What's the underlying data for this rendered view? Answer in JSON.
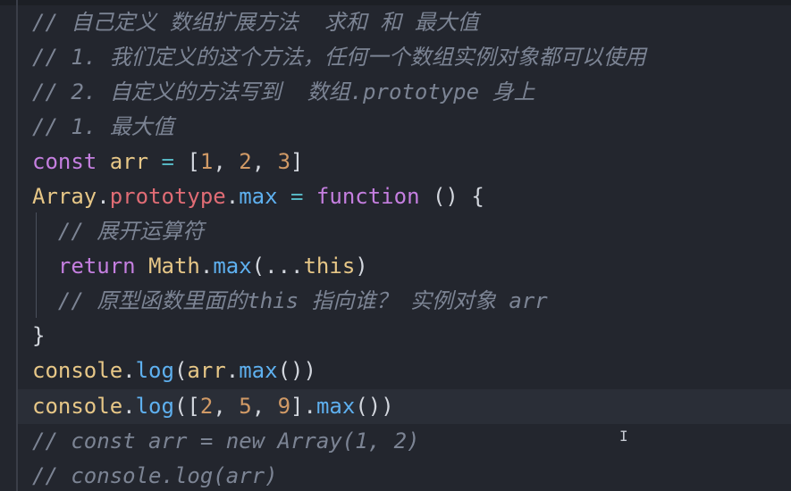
{
  "editor": {
    "lines": [
      {
        "segments": [
          {
            "text": "// 自己定义 数组扩展方法  求和 和 最大值",
            "cls": "comment"
          }
        ]
      },
      {
        "segments": [
          {
            "text": "// 1. 我们定义的这个方法，任何一个数组实例对象都可以使用",
            "cls": "comment"
          }
        ]
      },
      {
        "segments": [
          {
            "text": "// 2. 自定义的方法写到  数组.prototype 身上",
            "cls": "comment"
          }
        ]
      },
      {
        "segments": [
          {
            "text": "// 1. 最大值",
            "cls": "comment"
          }
        ]
      },
      {
        "segments": [
          {
            "text": "const",
            "cls": "kw"
          },
          {
            "text": " ",
            "cls": "punc"
          },
          {
            "text": "arr",
            "cls": "id"
          },
          {
            "text": " ",
            "cls": "punc"
          },
          {
            "text": "=",
            "cls": "op"
          },
          {
            "text": " [",
            "cls": "punc"
          },
          {
            "text": "1",
            "cls": "num"
          },
          {
            "text": ", ",
            "cls": "punc"
          },
          {
            "text": "2",
            "cls": "num"
          },
          {
            "text": ", ",
            "cls": "punc"
          },
          {
            "text": "3",
            "cls": "num"
          },
          {
            "text": "]",
            "cls": "punc"
          }
        ]
      },
      {
        "segments": [
          {
            "text": "Array",
            "cls": "id"
          },
          {
            "text": ".",
            "cls": "punc"
          },
          {
            "text": "prototype",
            "cls": "prop"
          },
          {
            "text": ".",
            "cls": "punc"
          },
          {
            "text": "max",
            "cls": "fn"
          },
          {
            "text": " ",
            "cls": "punc"
          },
          {
            "text": "=",
            "cls": "op"
          },
          {
            "text": " ",
            "cls": "punc"
          },
          {
            "text": "function",
            "cls": "kw"
          },
          {
            "text": " () {",
            "cls": "punc"
          }
        ]
      },
      {
        "segments": [
          {
            "text": "  // 展开运算符",
            "cls": "comment"
          }
        ]
      },
      {
        "segments": [
          {
            "text": "  ",
            "cls": "punc"
          },
          {
            "text": "return",
            "cls": "kw"
          },
          {
            "text": " ",
            "cls": "punc"
          },
          {
            "text": "Math",
            "cls": "id"
          },
          {
            "text": ".",
            "cls": "punc"
          },
          {
            "text": "max",
            "cls": "fn"
          },
          {
            "text": "(...",
            "cls": "punc"
          },
          {
            "text": "this",
            "cls": "id"
          },
          {
            "text": ")",
            "cls": "punc"
          }
        ]
      },
      {
        "segments": [
          {
            "text": "  // 原型函数里面的this 指向谁？ 实例对象 arr",
            "cls": "comment"
          }
        ]
      },
      {
        "segments": [
          {
            "text": "}",
            "cls": "punc"
          }
        ]
      },
      {
        "segments": [
          {
            "text": "console",
            "cls": "id"
          },
          {
            "text": ".",
            "cls": "punc"
          },
          {
            "text": "log",
            "cls": "fn"
          },
          {
            "text": "(",
            "cls": "punc"
          },
          {
            "text": "arr",
            "cls": "id"
          },
          {
            "text": ".",
            "cls": "punc"
          },
          {
            "text": "max",
            "cls": "fn"
          },
          {
            "text": "())",
            "cls": "punc"
          }
        ]
      },
      {
        "segments": [
          {
            "text": "console",
            "cls": "id"
          },
          {
            "text": ".",
            "cls": "punc"
          },
          {
            "text": "log",
            "cls": "fn"
          },
          {
            "text": "([",
            "cls": "punc"
          },
          {
            "text": "2",
            "cls": "num"
          },
          {
            "text": ", ",
            "cls": "punc"
          },
          {
            "text": "5",
            "cls": "num"
          },
          {
            "text": ", ",
            "cls": "punc"
          },
          {
            "text": "9",
            "cls": "num"
          },
          {
            "text": "].",
            "cls": "punc"
          },
          {
            "text": "max",
            "cls": "fn"
          },
          {
            "text": "())",
            "cls": "punc"
          }
        ]
      },
      {
        "segments": [
          {
            "text": "// const arr = new Array(1, 2)",
            "cls": "comment"
          }
        ]
      },
      {
        "segments": [
          {
            "text": "// console.log(arr)",
            "cls": "comment"
          }
        ]
      }
    ]
  },
  "colors": {
    "background": "#23262e",
    "comment": "#7c8494",
    "keyword": "#c57fe0",
    "identifier": "#e7c787",
    "property": "#e06c75",
    "function": "#5eb0ef",
    "number": "#d19a66"
  },
  "cursor_icon": "text-cursor-icon"
}
